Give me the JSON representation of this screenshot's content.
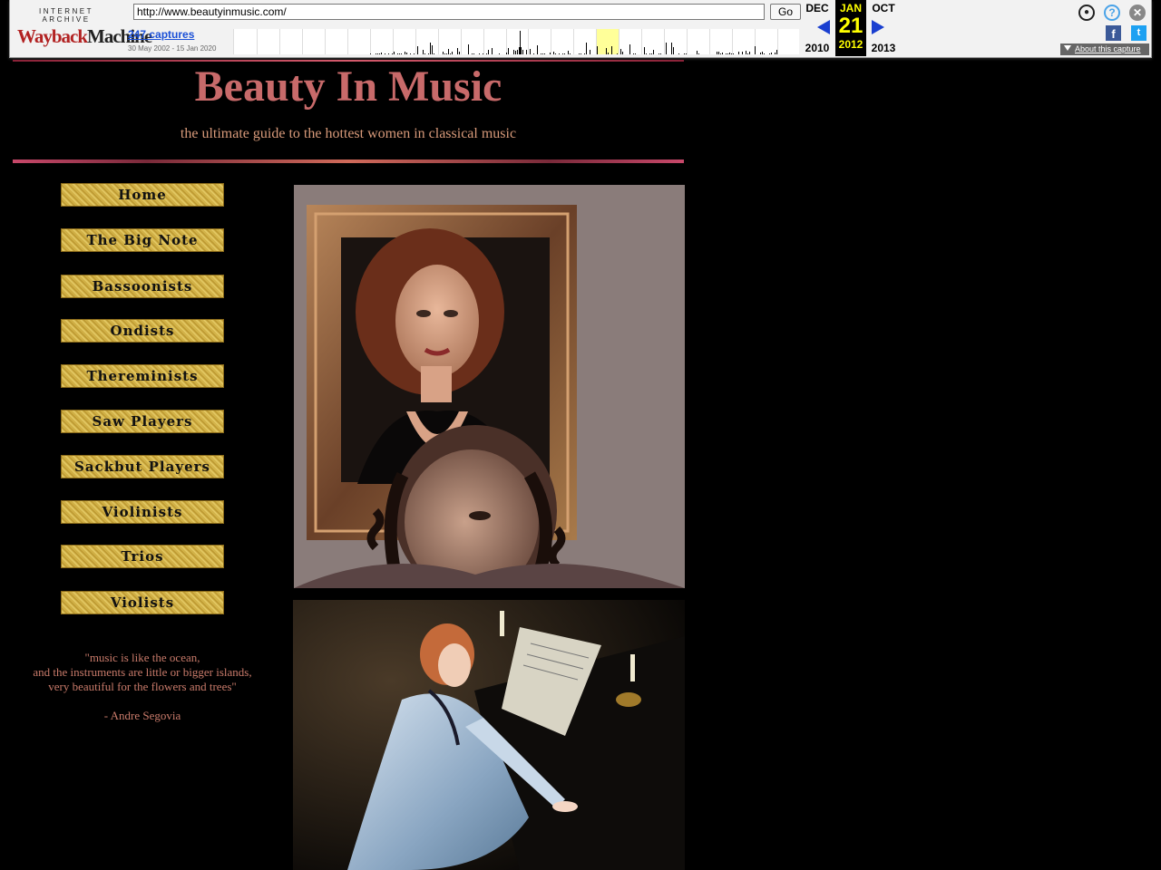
{
  "wayback": {
    "logo_top": "INTERNET ARCHIVE",
    "logo_main_a": "Wayback",
    "logo_main_b": "Machine",
    "url": "http://www.beautyinmusic.com/",
    "go_label": "Go",
    "captures": "247 captures",
    "range": "30 May 2002 - 15 Jan 2020",
    "prev_month": "DEC",
    "prev_year": "2010",
    "cur_month": "JAN",
    "cur_day": "21",
    "cur_year": "2012",
    "next_month": "OCT",
    "next_year": "2013",
    "about": "About this capture",
    "icons": {
      "user": "user-icon",
      "help": "help-icon",
      "close": "close-icon",
      "facebook": "facebook-icon",
      "twitter": "twitter-icon"
    }
  },
  "site": {
    "title": "Beauty In Music",
    "tagline": "the ultimate guide to the hottest women in classical music",
    "nav": [
      "Home",
      "The Big Note",
      "Bassoonists",
      "Ondists",
      "Thereminists",
      "Saw Players",
      "Sackbut Players",
      "Violinists",
      "Trios",
      "Violists"
    ],
    "quote": {
      "line1": "\"music is like the ocean,",
      "line2": "and the instruments are little or bigger islands,",
      "line3": "very beautiful for the flowers and trees\"",
      "author": "- Andre Segovia"
    }
  },
  "colors": {
    "background": "#000000",
    "title": "#c86a6a",
    "tagline": "#d89a7a",
    "quote": "#c87a6a",
    "nav_gold": "#d4b445"
  }
}
